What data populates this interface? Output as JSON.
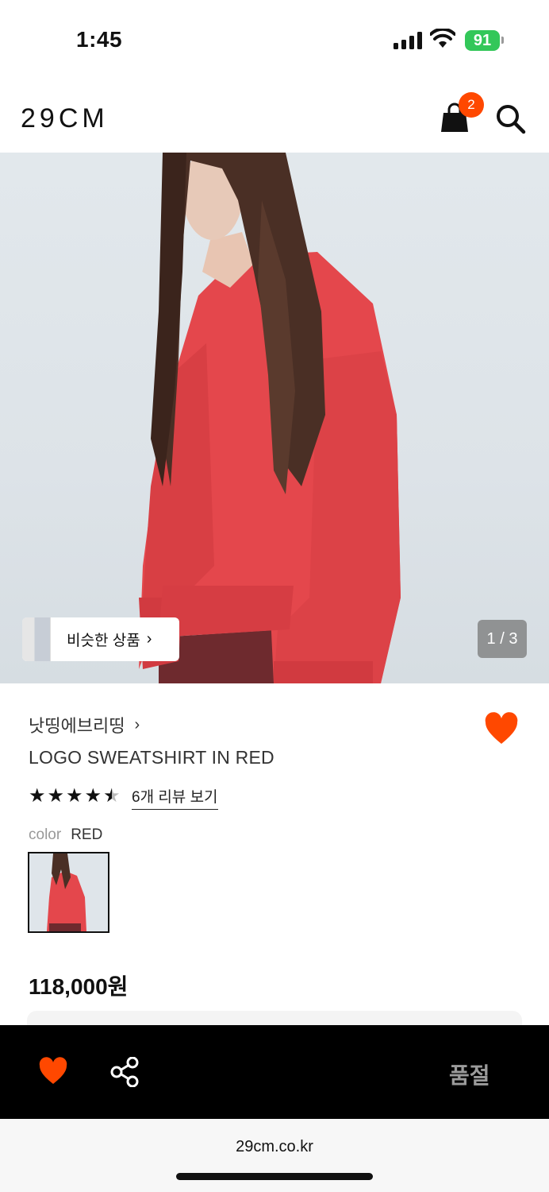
{
  "status_bar": {
    "time": "1:45",
    "battery": "91"
  },
  "header": {
    "logo": "29CM",
    "cart_count": "2",
    "cart_icon": "shopping-bag-icon",
    "search_icon": "search-icon"
  },
  "hero": {
    "similar_label": "비슷한 상품",
    "pager": "1 / 3"
  },
  "product": {
    "brand": "낫띵에브리띵",
    "title": "LOGO SWEATSHIRT IN RED",
    "rating": 4.5,
    "review_link": "6개 리뷰 보기",
    "color_key": "color",
    "color_value": "RED",
    "price": "118,000원",
    "liked": true
  },
  "bottom_bar": {
    "status": "품절",
    "heart_color": "#ff4800"
  },
  "browser": {
    "url": "29cm.co.kr"
  },
  "colors": {
    "accent": "#ff4800",
    "sweater": "#e4474c",
    "background": "#e2e8ec"
  }
}
